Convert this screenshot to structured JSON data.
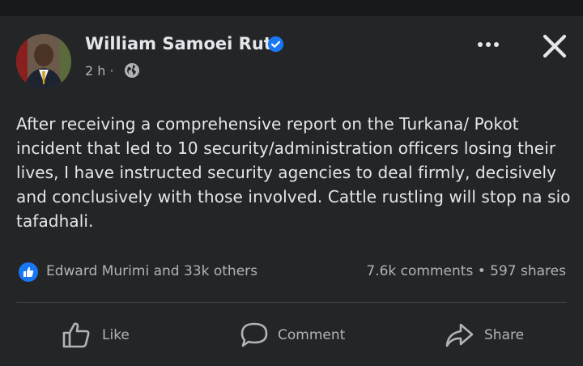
{
  "post": {
    "author": "William Samoei Ruto",
    "time": "2 h",
    "separator": "·",
    "body": "After receiving a comprehensive report on the Turkana/ Pokot incident that led to 10 security/administration officers losing their lives, I have instructed security agencies to deal firmly, decisively and conclusively with those involved. Cattle rustling will stop na sio tafadhali."
  },
  "engagement": {
    "reactions_text": "Edward Murimi and 33k others",
    "comments": "7.6k comments",
    "dot": "•",
    "shares": "597 shares"
  },
  "actions": {
    "like": "Like",
    "comment": "Comment",
    "share": "Share"
  },
  "colors": {
    "background": "#242526",
    "top_strip": "#18191a",
    "text_primary": "#e4e6eb",
    "text_secondary": "#b0b3b8",
    "accent_blue": "#1877f2"
  },
  "icons": {
    "verified": "verified-badge-icon",
    "privacy": "globe-icon",
    "more": "more-options-icon",
    "close": "close-icon",
    "like_badge": "like-reaction-icon",
    "like": "thumbs-up-icon",
    "comment": "comment-bubble-icon",
    "share": "share-arrow-icon"
  }
}
